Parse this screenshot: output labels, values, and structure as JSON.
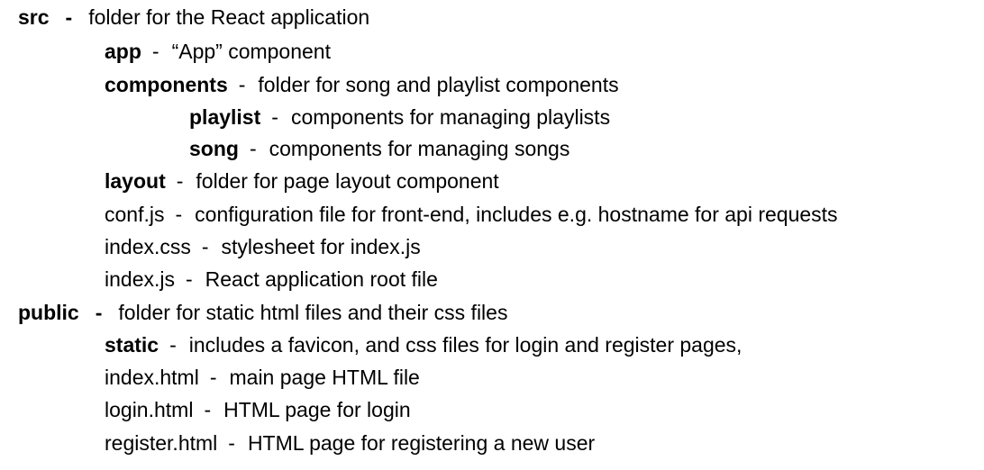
{
  "rows": [
    {
      "name": "src",
      "sep": "-",
      "desc": "folder for the React application"
    },
    {
      "name": "app",
      "sep": "-",
      "desc": "“App” component"
    },
    {
      "name": "components",
      "sep": "-",
      "desc": "folder for song and playlist components"
    },
    {
      "name": "playlist",
      "sep": "-",
      "desc": "components for managing playlists"
    },
    {
      "name": "song",
      "sep": "-",
      "desc": "components for managing songs"
    },
    {
      "name": "layout",
      "sep": "-",
      "desc": "folder for page layout component"
    },
    {
      "name": "conf.js",
      "sep": "-",
      "desc": "configuration file for front-end, includes e.g. hostname for api requests"
    },
    {
      "name": "index.css",
      "sep": "-",
      "desc": "stylesheet for index.js"
    },
    {
      "name": "index.js",
      "sep": "-",
      "desc": "React application root file"
    },
    {
      "name": "public",
      "sep": "-",
      "desc": "folder for static html files and their css files"
    },
    {
      "name": "static",
      "sep": "-",
      "desc": "includes a favicon, and css files for login and register pages,"
    },
    {
      "name": "index.html",
      "sep": "-",
      "desc": "main page HTML file"
    },
    {
      "name": "login.html",
      "sep": "-",
      "desc": "HTML page for login"
    },
    {
      "name": "register.html",
      "sep": "-",
      "desc": "HTML page for registering a new user"
    }
  ]
}
